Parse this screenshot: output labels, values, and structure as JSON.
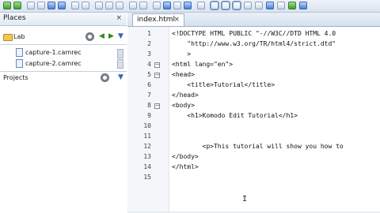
{
  "toolbar": {
    "icons": [
      "back-icon",
      "forward-icon",
      "new-file-icon",
      "open-icon",
      "save-icon",
      "save-all-icon",
      "undo-icon",
      "redo-icon",
      "cut-icon",
      "copy-icon",
      "paste-icon",
      "print-icon",
      "find-icon",
      "browser-icon",
      "macro-icon",
      "run-icon",
      "toolbox-icon",
      "places-icon",
      "projects-icon",
      "output-icon",
      "layout-icon",
      "help-icon"
    ]
  },
  "left_panel": {
    "places_tab": "Places",
    "places_close": "×",
    "folder_label": "Lab",
    "files": [
      "capture-1.camrec",
      "capture-2.camrec"
    ],
    "projects_label": "Projects"
  },
  "editor": {
    "tab_label": "index.html",
    "tab_close": "×",
    "line_numbers": [
      "1",
      "2",
      "3",
      "4",
      "5",
      "6",
      "7",
      "8",
      "9",
      "10",
      "11",
      "12",
      "13",
      "14",
      "15"
    ],
    "lines": [
      "<!DOCTYPE HTML PUBLIC \"-//W3C//DTD HTML 4.0",
      "    \"http://www.w3.org/TR/html4/strict.dtd\"",
      "    >",
      "<html lang=\"en\">",
      "<head>",
      "    <title>Tutorial</title>",
      "</head>",
      "<body>",
      "    <h1>Komodo Edit Tutorial</h1>",
      "",
      "",
      "        <p>This tutorial will show you how to ",
      "</body>",
      "</html>",
      ""
    ],
    "cursor_glyph": "I"
  }
}
